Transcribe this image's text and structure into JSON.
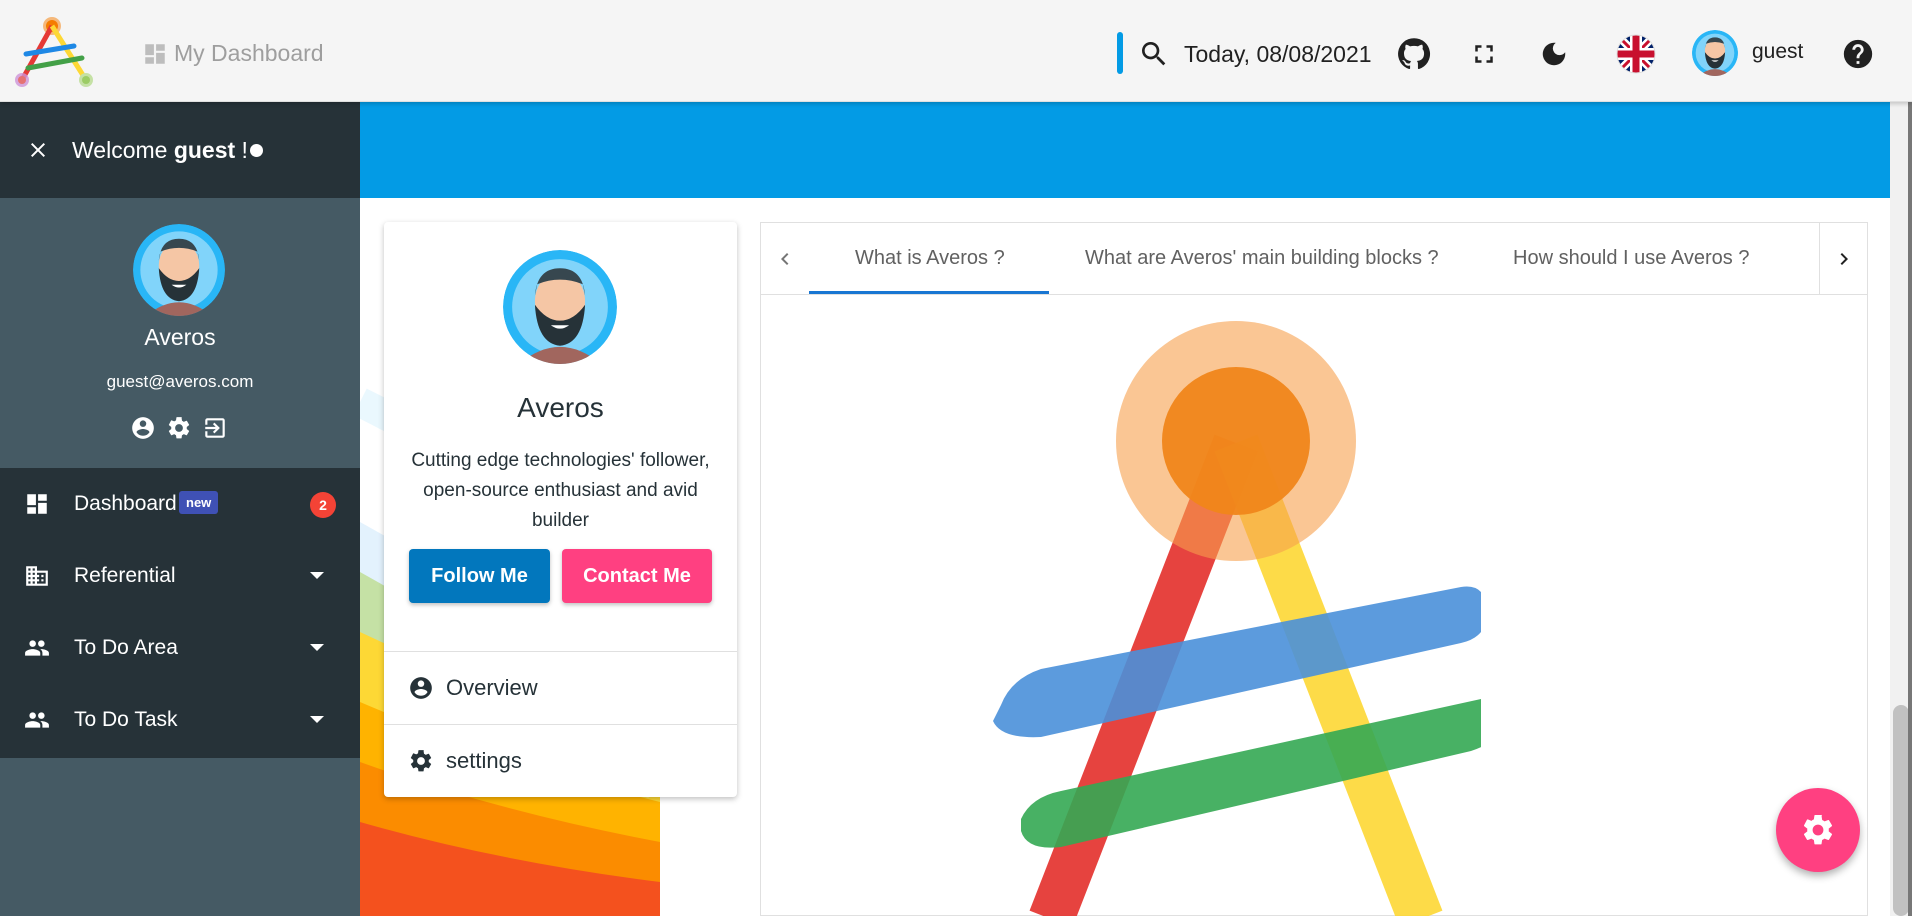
{
  "header": {
    "dashboard_label": "My Dashboard",
    "date_text": "Today, 08/08/2021",
    "username": "guest",
    "accent_color": "#039be5"
  },
  "sidebar": {
    "welcome_prefix": "Welcome ",
    "welcome_user": "guest",
    "welcome_suffix": " !",
    "profile_name": "Averos",
    "profile_email": "guest@averos.com",
    "menu": [
      {
        "label": "Dashboard",
        "icon": "dashboard-icon",
        "badge": "new",
        "count": "2"
      },
      {
        "label": "Referential",
        "icon": "business-icon"
      },
      {
        "label": "To Do Area",
        "icon": "people-icon"
      },
      {
        "label": "To Do Task",
        "icon": "people-icon"
      }
    ]
  },
  "profile_card": {
    "name": "Averos",
    "description": "Cutting edge technologies' follower, open-source enthusiast and avid builder",
    "follow_label": "Follow Me",
    "contact_label": "Contact Me",
    "links": [
      {
        "label": "Overview",
        "icon": "account-circle-icon"
      },
      {
        "label": "settings",
        "icon": "gear-icon"
      }
    ]
  },
  "tabs": {
    "items": [
      {
        "label": "What is Averos ?",
        "active": true
      },
      {
        "label": "What are Averos' main building blocks ?",
        "active": false
      },
      {
        "label": "How should I use Averos ?",
        "active": false
      }
    ]
  },
  "colors": {
    "sidebar_dark": "#263238",
    "sidebar": "#455a64",
    "primary": "#0277bd",
    "pink": "#ff4081"
  }
}
